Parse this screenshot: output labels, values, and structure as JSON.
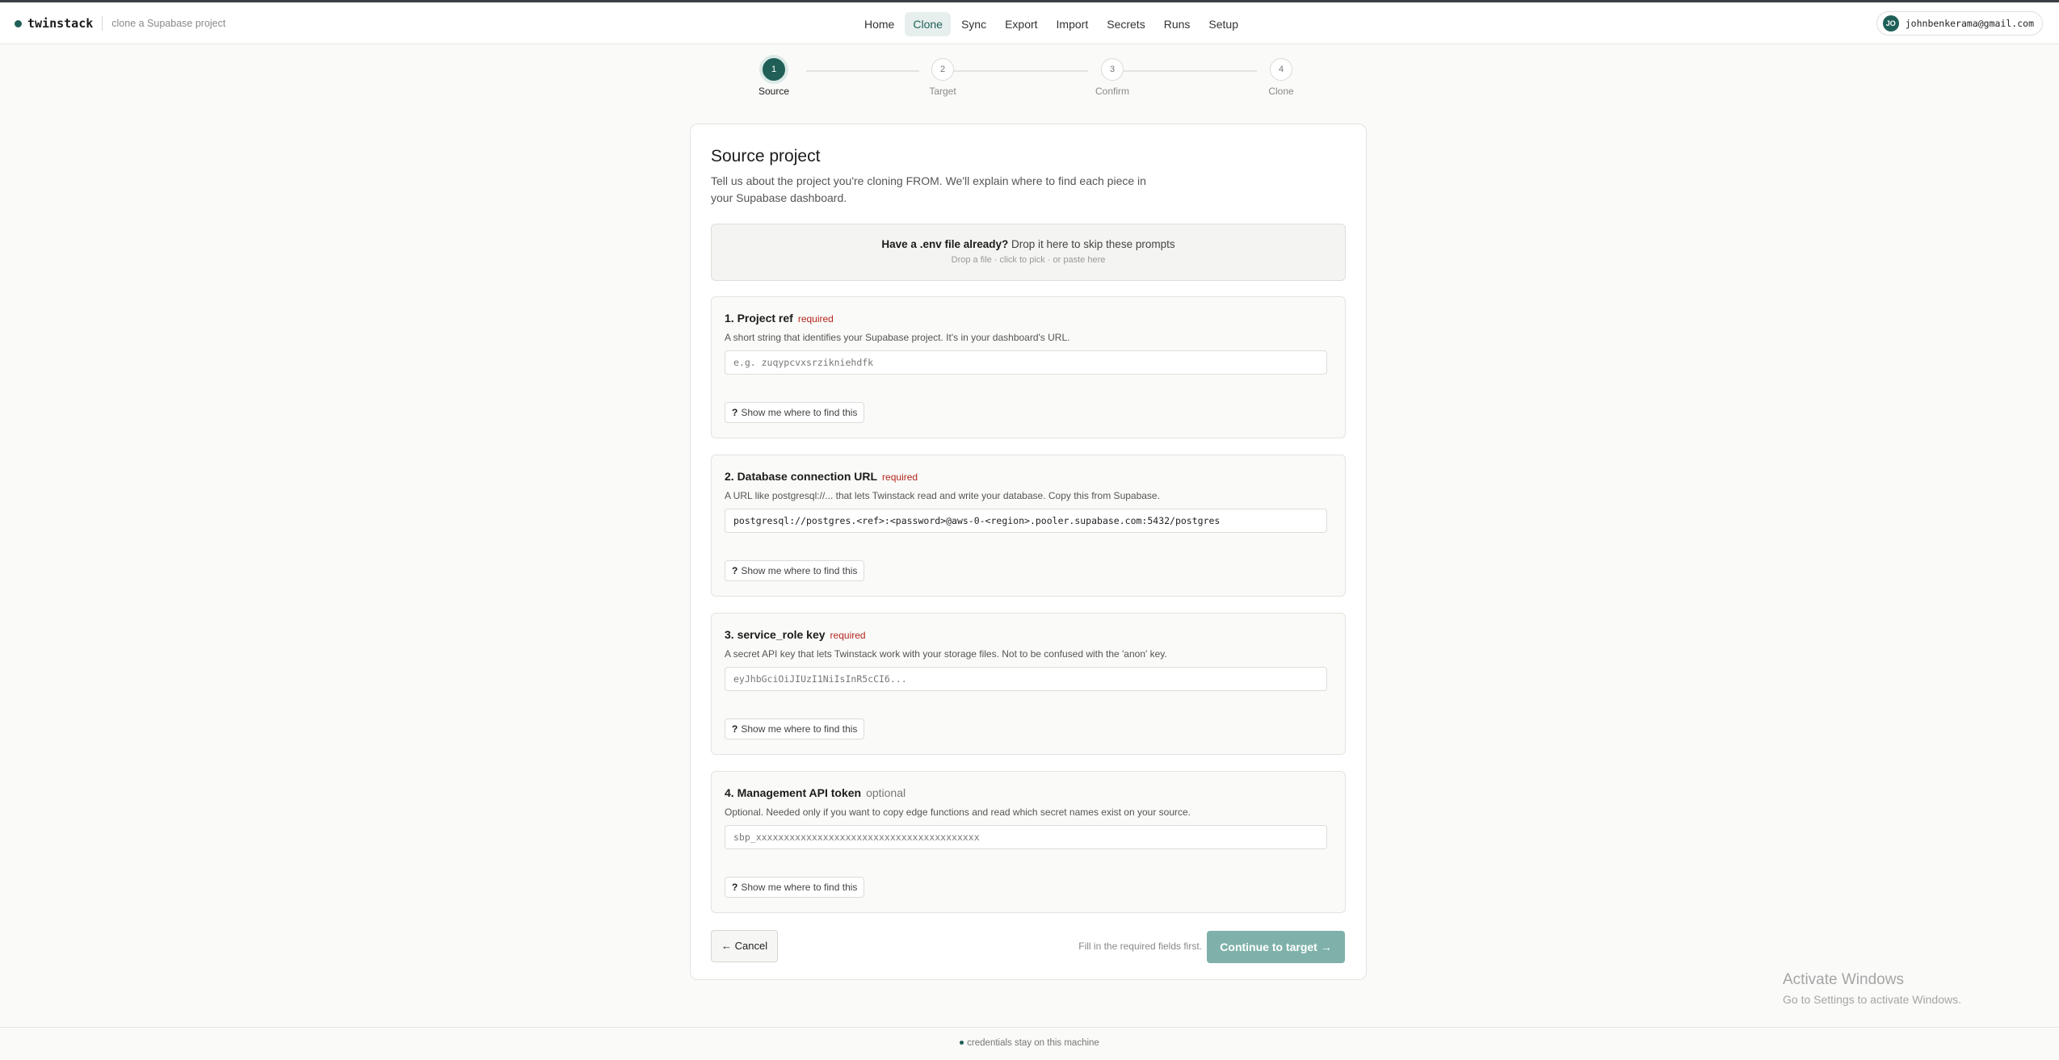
{
  "header": {
    "brand": "twinstack",
    "tagline": "clone a Supabase project",
    "nav": [
      "Home",
      "Clone",
      "Sync",
      "Export",
      "Import",
      "Secrets",
      "Runs",
      "Setup"
    ],
    "active_nav": "Clone",
    "user": {
      "initials": "JO",
      "email": "johnbenkerama@gmail.com"
    }
  },
  "stepper": {
    "steps": [
      {
        "number": "1",
        "label": "Source",
        "active": true
      },
      {
        "number": "2",
        "label": "Target",
        "active": false
      },
      {
        "number": "3",
        "label": "Confirm",
        "active": false
      },
      {
        "number": "4",
        "label": "Clone",
        "active": false
      }
    ]
  },
  "card": {
    "title": "Source project",
    "description": "Tell us about the project you're cloning FROM. We'll explain where to find each piece in your Supabase dashboard.",
    "dropzone": {
      "title": "Have a .env file already?",
      "title_rest": " Drop it here to skip these prompts",
      "subtitle": "Drop a file · click to pick · or paste here"
    },
    "fields": [
      {
        "title": "1. Project ref",
        "tag": "required",
        "help": "A short string that identifies your Supabase project. It's in your dashboard's URL.",
        "value": "",
        "placeholder": "e.g. zuqypcvxsrzikniehdfk",
        "help_button": "Show me where to find this"
      },
      {
        "title": "2. Database connection URL",
        "tag": "required",
        "help": "A URL like postgresql://... that lets Twinstack read and write your database. Copy this from Supabase.",
        "value": "postgresql://postgres.<ref>:<password>@aws-0-<region>.pooler.supabase.com:5432/postgres",
        "placeholder": "",
        "help_button": "Show me where to find this"
      },
      {
        "title": "3. service_role key",
        "tag": "required",
        "help": "A secret API key that lets Twinstack work with your storage files. Not to be confused with the 'anon' key.",
        "value": "",
        "placeholder": "eyJhbGciOiJIUzI1NiIsInR5cCI6...",
        "help_button": "Show me where to find this"
      },
      {
        "title": "4. Management API token",
        "tag": "optional",
        "help": "Optional. Needed only if you want to copy edge functions and read which secret names exist on your source.",
        "value": "",
        "placeholder": "sbp_xxxxxxxxxxxxxxxxxxxxxxxxxxxxxxxxxxxxxxxx",
        "help_button": "Show me where to find this"
      }
    ],
    "cancel_label": "← Cancel",
    "footer_hint": "Fill in the required fields first.",
    "continue_label": "Continue to target →"
  },
  "footer": {
    "text": "credentials stay on this machine"
  },
  "watermark": {
    "title": "Activate Windows",
    "subtitle": "Go to Settings to activate Windows."
  },
  "colors": {
    "accent": "#1f5f57",
    "accent_disabled": "#7fb1aa",
    "required": "#b3261e"
  }
}
